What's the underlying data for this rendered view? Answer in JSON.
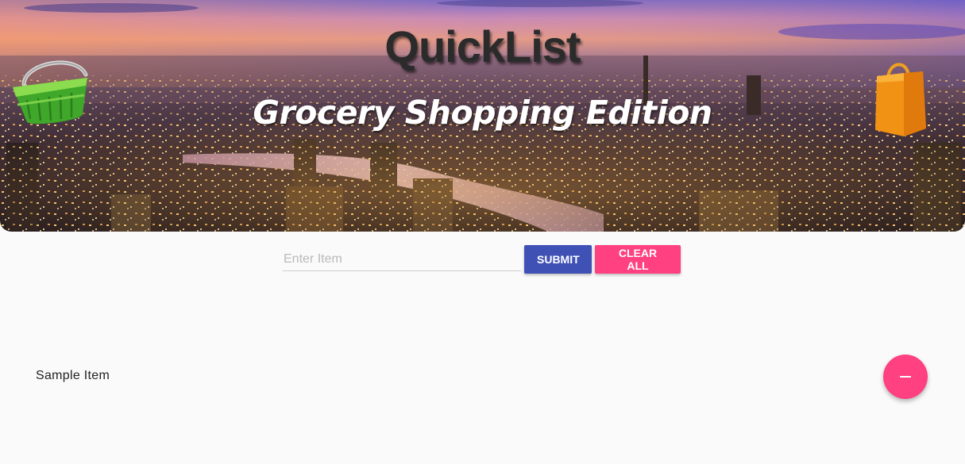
{
  "header": {
    "title": "QuickList",
    "subtitle": "Grocery Shopping Edition",
    "left_icon": "shopping-basket-icon",
    "right_icon": "shopping-bag-icon"
  },
  "form": {
    "input_placeholder": "Enter Item",
    "input_value": "",
    "submit_label": "SUBMIT",
    "clear_label": "CLEAR ALL"
  },
  "list": {
    "items": [
      {
        "label": "Sample Item",
        "remove_icon": "minus-icon"
      }
    ]
  },
  "colors": {
    "primary": "#3f51b5",
    "accent": "#ff4081",
    "background": "#fbfafb"
  }
}
